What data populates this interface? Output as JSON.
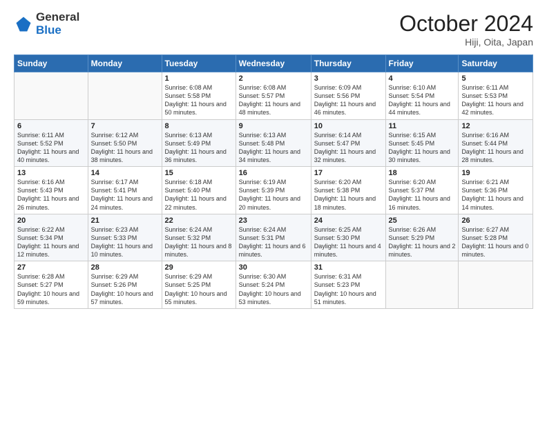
{
  "header": {
    "logo_general": "General",
    "logo_blue": "Blue",
    "month_title": "October 2024",
    "location": "Hiji, Oita, Japan"
  },
  "days_of_week": [
    "Sunday",
    "Monday",
    "Tuesday",
    "Wednesday",
    "Thursday",
    "Friday",
    "Saturday"
  ],
  "weeks": [
    [
      {
        "day": "",
        "text": ""
      },
      {
        "day": "",
        "text": ""
      },
      {
        "day": "1",
        "text": "Sunrise: 6:08 AM\nSunset: 5:58 PM\nDaylight: 11 hours and 50 minutes."
      },
      {
        "day": "2",
        "text": "Sunrise: 6:08 AM\nSunset: 5:57 PM\nDaylight: 11 hours and 48 minutes."
      },
      {
        "day": "3",
        "text": "Sunrise: 6:09 AM\nSunset: 5:56 PM\nDaylight: 11 hours and 46 minutes."
      },
      {
        "day": "4",
        "text": "Sunrise: 6:10 AM\nSunset: 5:54 PM\nDaylight: 11 hours and 44 minutes."
      },
      {
        "day": "5",
        "text": "Sunrise: 6:11 AM\nSunset: 5:53 PM\nDaylight: 11 hours and 42 minutes."
      }
    ],
    [
      {
        "day": "6",
        "text": "Sunrise: 6:11 AM\nSunset: 5:52 PM\nDaylight: 11 hours and 40 minutes."
      },
      {
        "day": "7",
        "text": "Sunrise: 6:12 AM\nSunset: 5:50 PM\nDaylight: 11 hours and 38 minutes."
      },
      {
        "day": "8",
        "text": "Sunrise: 6:13 AM\nSunset: 5:49 PM\nDaylight: 11 hours and 36 minutes."
      },
      {
        "day": "9",
        "text": "Sunrise: 6:13 AM\nSunset: 5:48 PM\nDaylight: 11 hours and 34 minutes."
      },
      {
        "day": "10",
        "text": "Sunrise: 6:14 AM\nSunset: 5:47 PM\nDaylight: 11 hours and 32 minutes."
      },
      {
        "day": "11",
        "text": "Sunrise: 6:15 AM\nSunset: 5:45 PM\nDaylight: 11 hours and 30 minutes."
      },
      {
        "day": "12",
        "text": "Sunrise: 6:16 AM\nSunset: 5:44 PM\nDaylight: 11 hours and 28 minutes."
      }
    ],
    [
      {
        "day": "13",
        "text": "Sunrise: 6:16 AM\nSunset: 5:43 PM\nDaylight: 11 hours and 26 minutes."
      },
      {
        "day": "14",
        "text": "Sunrise: 6:17 AM\nSunset: 5:41 PM\nDaylight: 11 hours and 24 minutes."
      },
      {
        "day": "15",
        "text": "Sunrise: 6:18 AM\nSunset: 5:40 PM\nDaylight: 11 hours and 22 minutes."
      },
      {
        "day": "16",
        "text": "Sunrise: 6:19 AM\nSunset: 5:39 PM\nDaylight: 11 hours and 20 minutes."
      },
      {
        "day": "17",
        "text": "Sunrise: 6:20 AM\nSunset: 5:38 PM\nDaylight: 11 hours and 18 minutes."
      },
      {
        "day": "18",
        "text": "Sunrise: 6:20 AM\nSunset: 5:37 PM\nDaylight: 11 hours and 16 minutes."
      },
      {
        "day": "19",
        "text": "Sunrise: 6:21 AM\nSunset: 5:36 PM\nDaylight: 11 hours and 14 minutes."
      }
    ],
    [
      {
        "day": "20",
        "text": "Sunrise: 6:22 AM\nSunset: 5:34 PM\nDaylight: 11 hours and 12 minutes."
      },
      {
        "day": "21",
        "text": "Sunrise: 6:23 AM\nSunset: 5:33 PM\nDaylight: 11 hours and 10 minutes."
      },
      {
        "day": "22",
        "text": "Sunrise: 6:24 AM\nSunset: 5:32 PM\nDaylight: 11 hours and 8 minutes."
      },
      {
        "day": "23",
        "text": "Sunrise: 6:24 AM\nSunset: 5:31 PM\nDaylight: 11 hours and 6 minutes."
      },
      {
        "day": "24",
        "text": "Sunrise: 6:25 AM\nSunset: 5:30 PM\nDaylight: 11 hours and 4 minutes."
      },
      {
        "day": "25",
        "text": "Sunrise: 6:26 AM\nSunset: 5:29 PM\nDaylight: 11 hours and 2 minutes."
      },
      {
        "day": "26",
        "text": "Sunrise: 6:27 AM\nSunset: 5:28 PM\nDaylight: 11 hours and 0 minutes."
      }
    ],
    [
      {
        "day": "27",
        "text": "Sunrise: 6:28 AM\nSunset: 5:27 PM\nDaylight: 10 hours and 59 minutes."
      },
      {
        "day": "28",
        "text": "Sunrise: 6:29 AM\nSunset: 5:26 PM\nDaylight: 10 hours and 57 minutes."
      },
      {
        "day": "29",
        "text": "Sunrise: 6:29 AM\nSunset: 5:25 PM\nDaylight: 10 hours and 55 minutes."
      },
      {
        "day": "30",
        "text": "Sunrise: 6:30 AM\nSunset: 5:24 PM\nDaylight: 10 hours and 53 minutes."
      },
      {
        "day": "31",
        "text": "Sunrise: 6:31 AM\nSunset: 5:23 PM\nDaylight: 10 hours and 51 minutes."
      },
      {
        "day": "",
        "text": ""
      },
      {
        "day": "",
        "text": ""
      }
    ]
  ]
}
